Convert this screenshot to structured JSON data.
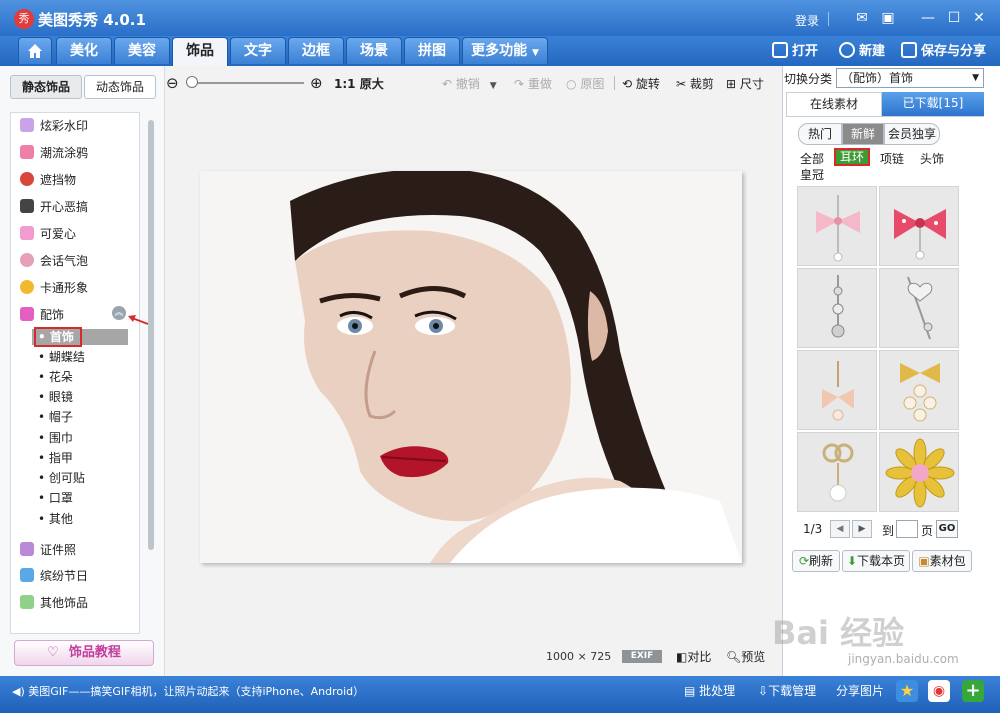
{
  "title_bar": {
    "logo_text": "秀",
    "app_title": "美图秀秀 4.0.1",
    "login": "登录"
  },
  "main_tabs": [
    "美化",
    "美容",
    "饰品",
    "文字",
    "边框",
    "场景",
    "拼图",
    "更多功能"
  ],
  "top_right": {
    "open": "打开",
    "new": "新建",
    "save_share": "保存与分享"
  },
  "left_panel": {
    "tabs": [
      "静态饰品",
      "动态饰品"
    ],
    "categories": [
      "炫彩水印",
      "潮流涂鸦",
      "遮挡物",
      "开心恶搞",
      "可爱心",
      "会话气泡",
      "卡通形象",
      "配饰"
    ],
    "sub_items": [
      "首饰",
      "蝴蝶结",
      "花朵",
      "眼镜",
      "帽子",
      "围巾",
      "指甲",
      "创可贴",
      "口罩",
      "其他"
    ],
    "bottom_categories": [
      "证件照",
      "缤纷节日",
      "其他饰品"
    ],
    "tutorial_button": "饰品教程"
  },
  "toolbar": {
    "ratio": "1:1",
    "original": "原大",
    "undo": "撤销",
    "redo": "重做",
    "original_image": "原图",
    "rotate": "旋转",
    "crop": "裁剪",
    "resize": "尺寸"
  },
  "status": {
    "width": "1000",
    "times": "×",
    "height": "725",
    "exif": "EXIF",
    "compare": "对比",
    "preview": "预览"
  },
  "right_panel": {
    "switch_label": "切换分类",
    "switch_value": "（配饰）首饰",
    "tabs": [
      "在线素材",
      "已下载[15]"
    ],
    "pills": [
      "热门",
      "新鲜",
      "会员独享"
    ],
    "subcats": [
      "全部",
      "耳环",
      "项链",
      "头饰",
      "皇冠"
    ],
    "pager": {
      "page": "1/3",
      "goto": "到",
      "unit": "页",
      "go": "GO"
    },
    "buttons": [
      "刷新",
      "下载本页",
      "素材包"
    ]
  },
  "bottom_bar": {
    "news": "美图GIF——搞笑GIF相机，让照片动起来（支持iPhone、Android）",
    "batch": "批处理",
    "download_mgr": "下载管理",
    "share": "分享图片"
  },
  "watermark": {
    "text": "Bai 经验",
    "url": "jingyan.baidu.com"
  },
  "colors": {
    "accent": "#2a6fc8",
    "selected_highlight": "#d62b2b",
    "subcat_active": "#3d9b35",
    "lips": "#b3142a"
  }
}
